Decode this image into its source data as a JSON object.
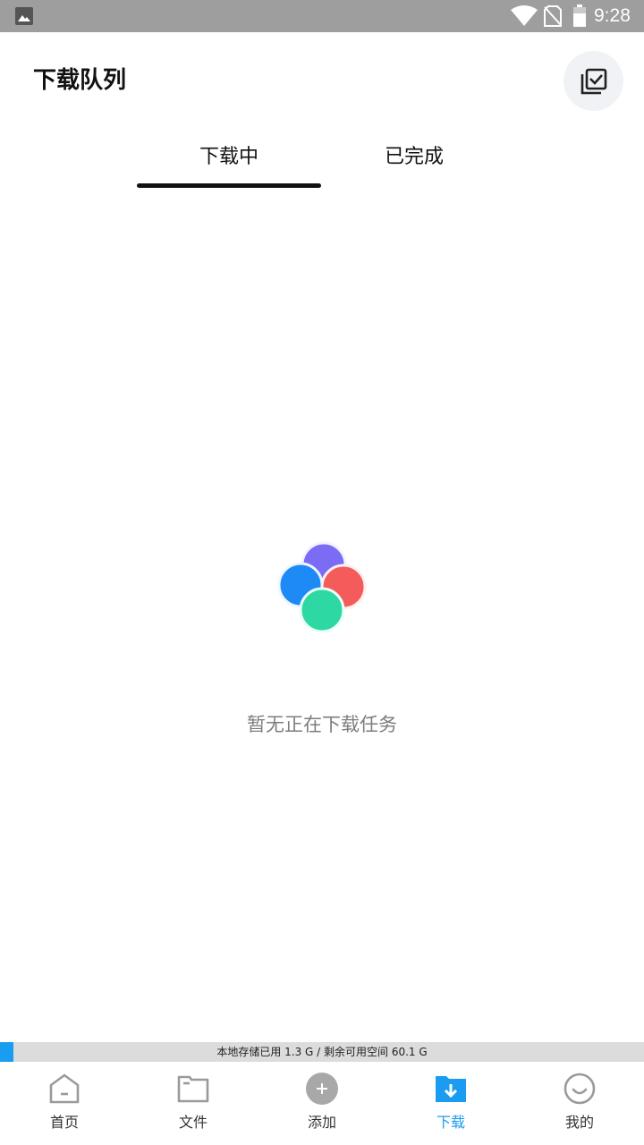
{
  "status_bar": {
    "time": "9:28",
    "icons": [
      "image-notification-icon",
      "wifi-icon",
      "no-sim-icon",
      "battery-icon"
    ]
  },
  "header": {
    "title": "下载队列",
    "select_icon": "multi-select-checkbox-icon"
  },
  "tabs": [
    {
      "label": "下载中",
      "active": true
    },
    {
      "label": "已完成",
      "active": false
    }
  ],
  "empty_state": {
    "logo": "four-circle-logo-icon",
    "message": "暂无正在下载任务"
  },
  "storage": {
    "text": "本地存储已用 1.3 G / 剩余可用空间 60.1 G",
    "used_fraction": 0.021
  },
  "bottom_nav": [
    {
      "label": "首页",
      "icon": "home-icon",
      "active": false
    },
    {
      "label": "文件",
      "icon": "folder-icon",
      "active": false
    },
    {
      "label": "添加",
      "icon": "add-icon",
      "active": false
    },
    {
      "label": "下载",
      "icon": "download-folder-icon",
      "active": true
    },
    {
      "label": "我的",
      "icon": "profile-smile-icon",
      "active": false
    }
  ],
  "colors": {
    "accent": "#1a9cf0",
    "status_bar": "#9e9e9e",
    "logo_purple": "#7b6cf6",
    "logo_red": "#f45b5b",
    "logo_blue": "#1e8af5",
    "logo_green": "#2ed8a3"
  }
}
